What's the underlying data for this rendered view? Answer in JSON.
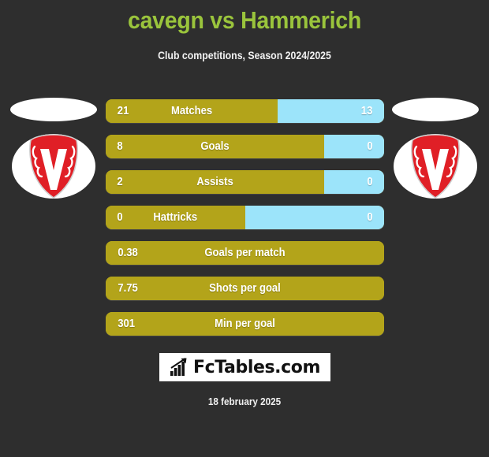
{
  "header": {
    "title": "cavegn vs Hammerich",
    "subtitle": "Club competitions, Season 2024/2025",
    "title_color": "#9ac43c"
  },
  "colors": {
    "background": "#2e2e2e",
    "home_bar": "#b3a41a",
    "away_bar": "#9ce4fa",
    "crest_red": "#e01f26",
    "badge_bg": "#ffffff"
  },
  "badges": {
    "left": {
      "icon": "club-crest-icon",
      "alt": "club crest"
    },
    "right": {
      "icon": "club-crest-icon",
      "alt": "club crest"
    }
  },
  "stats": [
    {
      "label": "Matches",
      "home": "21",
      "away": "13",
      "home_pct": 61.8,
      "dual": true
    },
    {
      "label": "Goals",
      "home": "8",
      "away": "0",
      "home_pct": 78.5,
      "dual": true
    },
    {
      "label": "Assists",
      "home": "2",
      "away": "0",
      "home_pct": 78.5,
      "dual": true
    },
    {
      "label": "Hattricks",
      "home": "0",
      "away": "0",
      "home_pct": 50.0,
      "dual": true
    },
    {
      "label": "Goals per match",
      "home": "0.38",
      "away": "",
      "home_pct": 100,
      "dual": false
    },
    {
      "label": "Shots per goal",
      "home": "7.75",
      "away": "",
      "home_pct": 100,
      "dual": false
    },
    {
      "label": "Min per goal",
      "home": "301",
      "away": "",
      "home_pct": 100,
      "dual": false
    }
  ],
  "footer": {
    "logo_text": "FcTables.com",
    "logo_icon": "bar-chart-arrow-icon",
    "date": "18 february 2025"
  }
}
